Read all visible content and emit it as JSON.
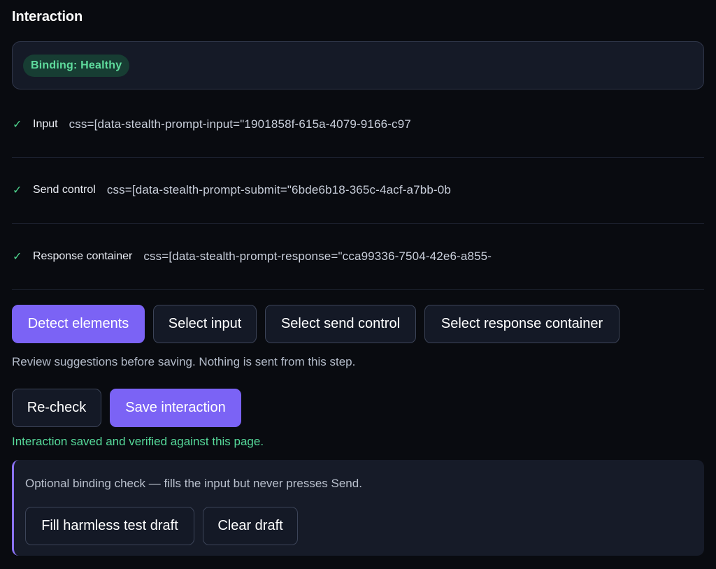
{
  "section": {
    "title": "Interaction"
  },
  "status": {
    "badge_label": "Binding: Healthy"
  },
  "bindings": [
    {
      "check_icon": "check-icon",
      "label": "Input",
      "selector": "css=[data-stealth-prompt-input=\"1901858f-615a-4079-9166-c97"
    },
    {
      "check_icon": "check-icon",
      "label": "Send control",
      "selector": "css=[data-stealth-prompt-submit=\"6bde6b18-365c-4acf-a7bb-0b"
    },
    {
      "check_icon": "check-icon",
      "label": "Response container",
      "selector": "css=[data-stealth-prompt-response=\"cca99336-7504-42e6-a855-"
    }
  ],
  "actions": {
    "detect_label": "Detect elements",
    "select_input_label": "Select input",
    "select_send_label": "Select send control",
    "select_response_label": "Select response container"
  },
  "hint": "Review suggestions before saving. Nothing is sent from this step.",
  "save_actions": {
    "recheck_label": "Re-check",
    "save_label": "Save interaction"
  },
  "success_message": "Interaction saved and verified against this page.",
  "optional_check": {
    "description": "Optional binding check — fills the input but never presses Send.",
    "fill_label": "Fill harmless test draft",
    "clear_label": "Clear draft"
  },
  "colors": {
    "background": "#090b10",
    "accent": "#7b63f5",
    "success": "#56d99a",
    "badge_bg": "#173d33"
  }
}
